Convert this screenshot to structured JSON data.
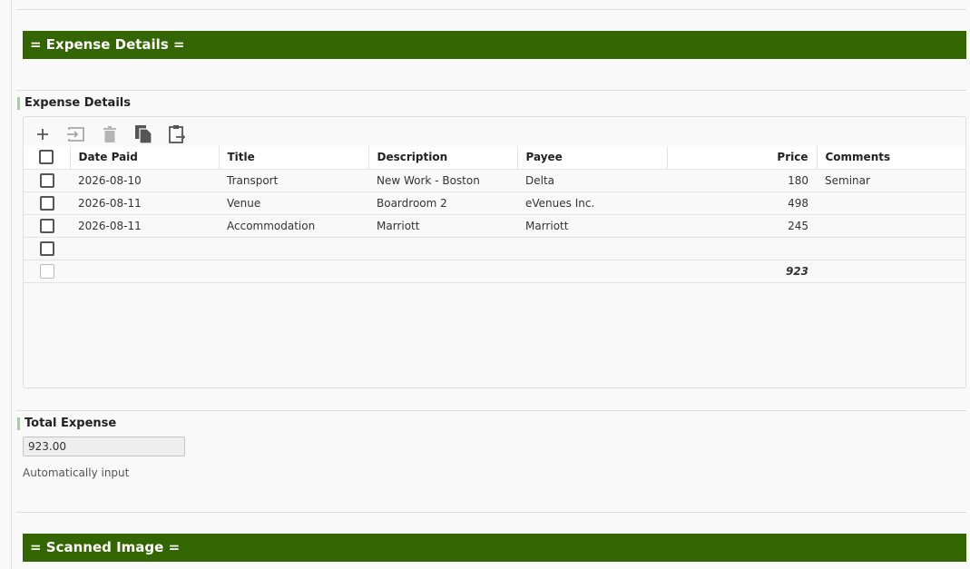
{
  "expense_section": {
    "header": "= Expense Details ="
  },
  "expense_grid": {
    "label": "Expense Details",
    "toolbar": [
      {
        "icon": "add-icon"
      },
      {
        "icon": "insert-icon"
      },
      {
        "icon": "delete-icon"
      },
      {
        "icon": "copy-icon"
      },
      {
        "icon": "paste-icon"
      }
    ],
    "columns": [
      "Date Paid",
      "Title",
      "Description",
      "Payee",
      "Price",
      "Comments"
    ],
    "rows": [
      {
        "date_paid": "2026-08-10",
        "title": "Transport",
        "description": "New Work - Boston",
        "payee": "Delta",
        "price": "180",
        "comments": "Seminar"
      },
      {
        "date_paid": "2026-08-11",
        "title": "Venue",
        "description": "Boardroom 2",
        "payee": "eVenues Inc.",
        "price": "498",
        "comments": ""
      },
      {
        "date_paid": "2026-08-11",
        "title": "Accommodation",
        "description": "Marriott",
        "payee": "Marriott",
        "price": "245",
        "comments": ""
      },
      {
        "date_paid": "",
        "title": "",
        "description": "",
        "payee": "",
        "price": "",
        "comments": ""
      }
    ],
    "total_price": "923"
  },
  "total_expense": {
    "label": "Total Expense",
    "value": "923.00",
    "help": "Automatically input"
  },
  "scanned_section": {
    "header": "= Scanned Image ="
  },
  "colors": {
    "section_header_bg": "#336600",
    "label_accent": "#9ad49a"
  }
}
